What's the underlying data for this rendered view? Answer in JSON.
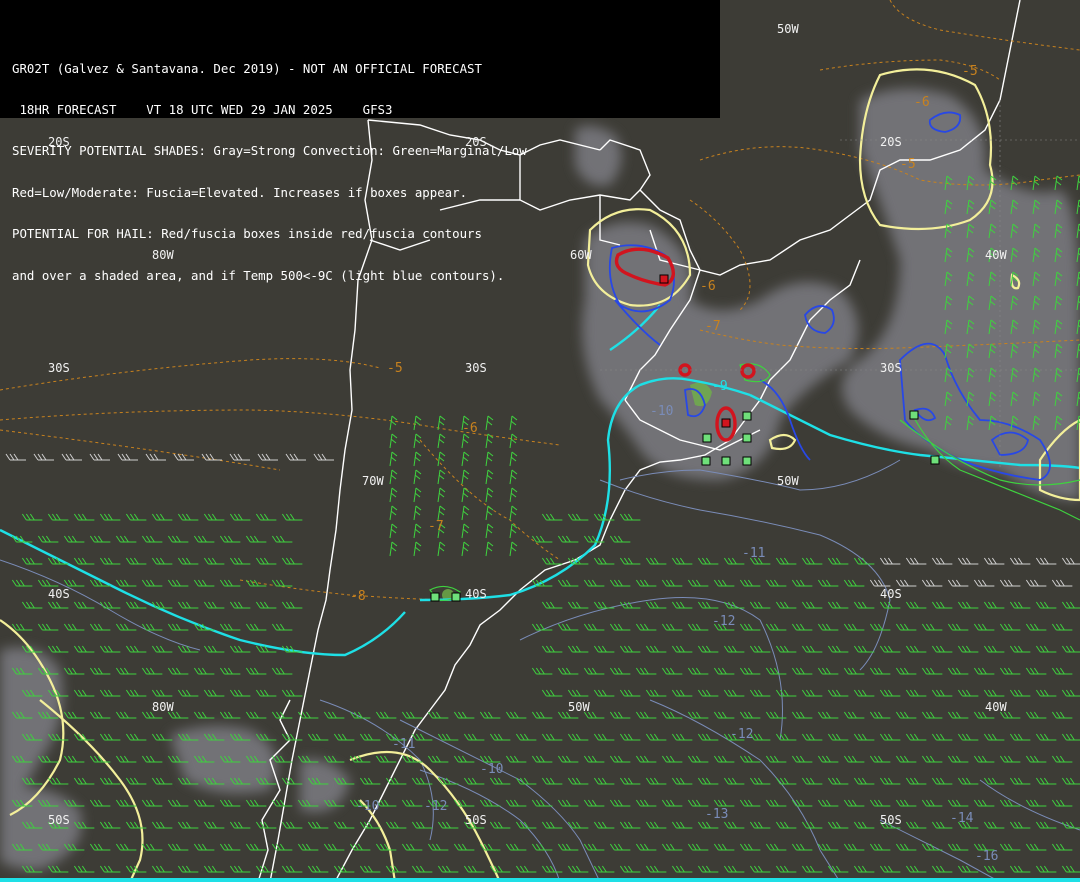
{
  "header": {
    "line1": "GR02T (Galvez & Santavana. Dec 2019) - NOT AN OFFICIAL FORECAST",
    "line2": " 18HR FORECAST    VT 18 UTC WED 29 JAN 2025    GFS3",
    "line3": "SEVERITY POTENTIAL SHADES: Gray=Strong Convection: Green=Marginal/Low",
    "line4": "Red=Low/Moderate: Fuscia=Elevated. Increases if boxes appear.",
    "line5": "POTENTIAL FOR HAIL: Red/fuscia boxes inside red/fuscia contours",
    "line6": "and over a shaded area, and if Temp 500<-9C (light blue contours)."
  },
  "grid_labels": {
    "lat20_left": "20S",
    "lat20_mid": "20S",
    "lat20_right": "20S",
    "lat30_left": "30S",
    "lat30_mid": "30S",
    "lat30_right": "30S",
    "lat40_left": "40S",
    "lat40_mid": "40S",
    "lat40_right": "40S",
    "lat50_left": "50S",
    "lat50_mid": "50S",
    "lat50_right": "50S",
    "lon50_top": "50W",
    "lon40_top": "40W",
    "lon60_top": "60W",
    "lon80_top": "80W",
    "lon70_mid": "70W",
    "lon50_mid": "50W",
    "lon80_bot": "80W",
    "lon50_bot": "50W",
    "lon40_bot": "40W"
  },
  "temperature_labels": {
    "t_m5a": "-5",
    "t_m6a": "-6",
    "t_m5b": "-5",
    "t_m5c": "-5",
    "t_m6b": "-6",
    "t_m7a": "-7",
    "t_m8": "-8",
    "t_m6c": "-6",
    "t_m7b": "-7",
    "t_m9": "-9",
    "t_m10a": "-10",
    "t_m11a": "-11",
    "t_m11b": "-11",
    "t_m12a": "-12",
    "t_m12b": "-12",
    "t_m10b": "-10",
    "t_m13": "-13",
    "t_m16": "-16",
    "t_m14": "-14",
    "t_m10c": "-10",
    "t_m12c": "-12"
  },
  "colors": {
    "background": "#3d3c36",
    "coast": "#ffffff",
    "orange_contour": "#c8821e",
    "slate_contour": "#7a8cb8",
    "cyan_contour": "#1ee0e6",
    "yellow_contour": "#f3ef9a",
    "blue_contour": "#2848e6",
    "green_barbs": "#3fd23f",
    "red_area": "#d2141e",
    "gray_shade": "#7a7a80"
  }
}
